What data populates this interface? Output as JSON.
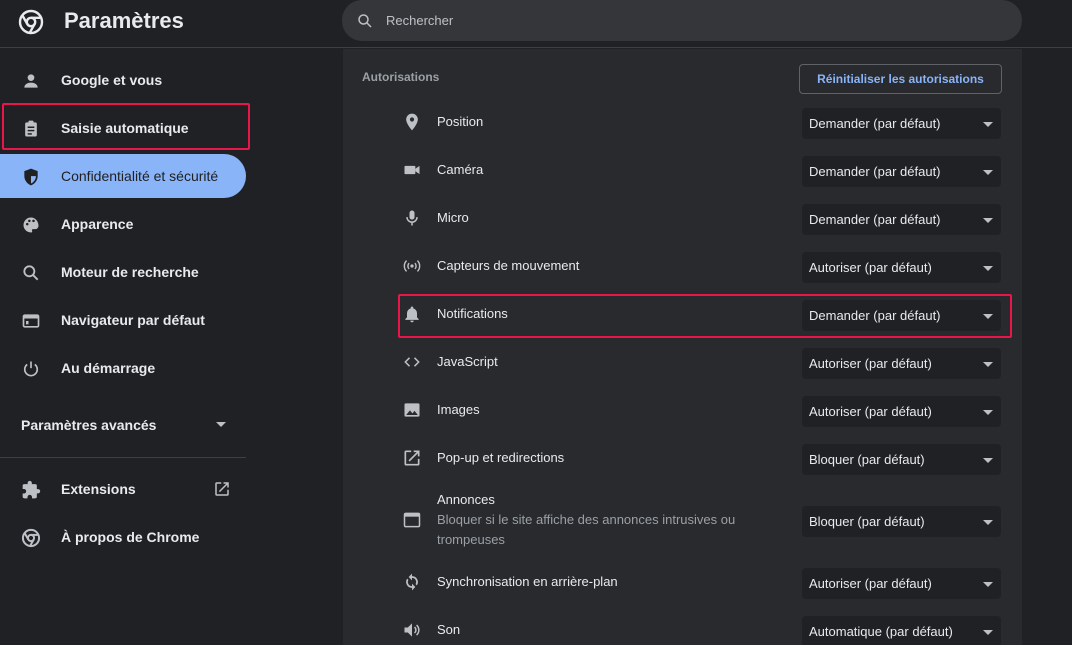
{
  "header": {
    "title": "Paramètres",
    "search_placeholder": "Rechercher",
    "logo_icon": "chrome-logo-icon"
  },
  "sidebar": {
    "items": [
      {
        "label": "Google et vous",
        "icon": "person-icon"
      },
      {
        "label": "Saisie automatique",
        "icon": "clipboard-icon"
      },
      {
        "label": "Confidentialité et sécurité",
        "icon": "shield-icon",
        "active": true
      },
      {
        "label": "Apparence",
        "icon": "palette-icon"
      },
      {
        "label": "Moteur de recherche",
        "icon": "search-icon"
      },
      {
        "label": "Navigateur par défaut",
        "icon": "browser-icon"
      },
      {
        "label": "Au démarrage",
        "icon": "power-icon"
      }
    ],
    "advanced_label": "Paramètres avancés",
    "extensions_label": "Extensions",
    "about_label": "À propos de Chrome"
  },
  "main": {
    "section_title": "Autorisations",
    "reset_label": "Réinitialiser les autorisations",
    "permissions": [
      {
        "label": "Position",
        "value": "Demander (par défaut)",
        "icon": "location-pin-icon"
      },
      {
        "label": "Caméra",
        "value": "Demander (par défaut)",
        "icon": "camera-icon"
      },
      {
        "label": "Micro",
        "value": "Demander (par défaut)",
        "icon": "microphone-icon"
      },
      {
        "label": "Capteurs de mouvement",
        "value": "Autoriser (par défaut)",
        "icon": "sensors-icon"
      },
      {
        "label": "Notifications",
        "value": "Demander (par défaut)",
        "icon": "bell-icon"
      },
      {
        "label": "JavaScript",
        "value": "Autoriser (par défaut)",
        "icon": "code-icon"
      },
      {
        "label": "Images",
        "value": "Autoriser (par défaut)",
        "icon": "image-icon"
      },
      {
        "label": "Pop-up et redirections",
        "value": "Bloquer (par défaut)",
        "icon": "open-in-new-icon"
      },
      {
        "label": "Annonces",
        "sublabel": "Bloquer si le site affiche des annonces intrusives ou trompeuses",
        "value": "Bloquer (par défaut)",
        "icon": "ad-window-icon"
      },
      {
        "label": "Synchronisation en arrière-plan",
        "value": "Autoriser (par défaut)",
        "icon": "sync-icon"
      },
      {
        "label": "Son",
        "value": "Automatique (par défaut)",
        "icon": "speaker-icon"
      }
    ]
  },
  "colors": {
    "accent": "#8ab4f8",
    "highlight": "#e8164a",
    "background": "#202124",
    "card": "#292a2d"
  }
}
